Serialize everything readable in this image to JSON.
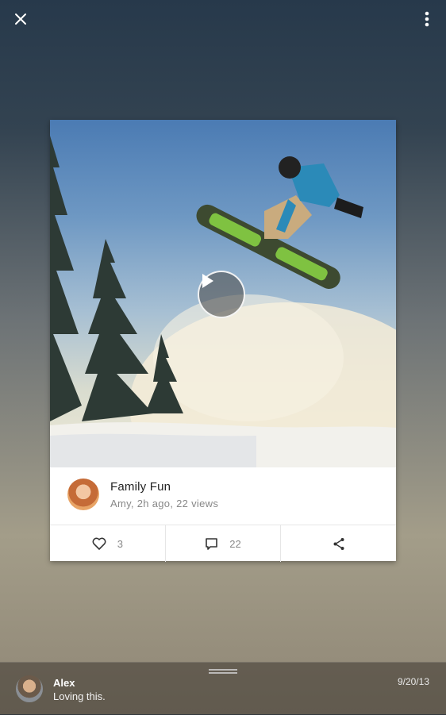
{
  "topbar": {
    "close_icon": "close-icon",
    "menu_icon": "more-vert-icon"
  },
  "post": {
    "title": "Family Fun",
    "meta": "Amy,  2h ago, 22 views",
    "author_avatar": "avatar-amy",
    "media": "snowboarder-jump-photo",
    "play_icon": "play-icon"
  },
  "actions": {
    "likes_count": "3",
    "comments_count": "22",
    "like_icon": "heart-icon",
    "comment_icon": "comment-icon",
    "share_icon": "share-icon"
  },
  "comment": {
    "author": "Alex",
    "text": "Loving this.",
    "date": "9/20/13"
  },
  "colors": {
    "card": "#ffffff",
    "meta_text": "#888888",
    "title_text": "#222222"
  }
}
